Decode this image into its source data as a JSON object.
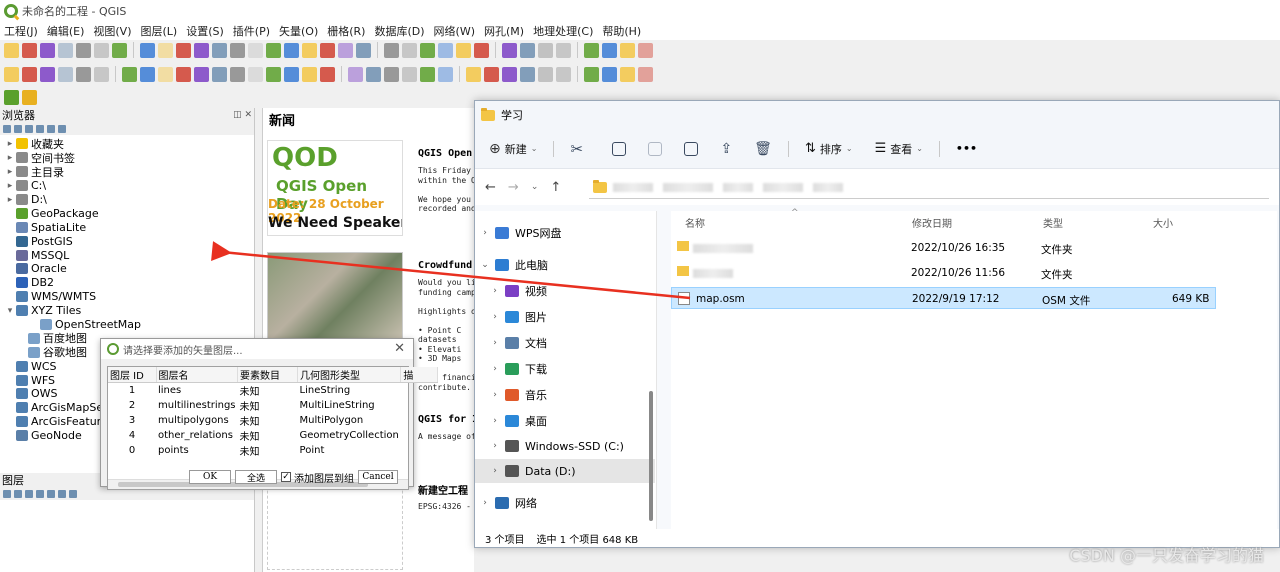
{
  "qgis": {
    "window_title": "未命名的工程 - QGIS",
    "menu": [
      "工程(J)",
      "编辑(E)",
      "视图(V)",
      "图层(L)",
      "设置(S)",
      "插件(P)",
      "矢量(O)",
      "栅格(R)",
      "数据库(D)",
      "网络(W)",
      "网孔(M)",
      "地理处理(C)",
      "帮助(H)"
    ],
    "browser_panel": {
      "title": "浏览器",
      "items": [
        {
          "label": "收藏夹",
          "expand": "▸",
          "color": "#f2c200"
        },
        {
          "label": "空间书签",
          "expand": "▸",
          "color": "#8a8a8a"
        },
        {
          "label": "主目录",
          "expand": "▸",
          "color": "#8a8a8a"
        },
        {
          "label": "C:\\",
          "expand": "▸",
          "color": "#8a8a8a"
        },
        {
          "label": "D:\\",
          "expand": "▸",
          "color": "#8a8a8a"
        },
        {
          "label": "GeoPackage",
          "expand": "",
          "color": "#5aa02c"
        },
        {
          "label": "SpatiaLite",
          "expand": "",
          "color": "#6a88b5"
        },
        {
          "label": "PostGIS",
          "expand": "",
          "color": "#336791"
        },
        {
          "label": "MSSQL",
          "expand": "",
          "color": "#6a6a9a"
        },
        {
          "label": "Oracle",
          "expand": "",
          "color": "#4a6aa0"
        },
        {
          "label": "DB2",
          "expand": "",
          "color": "#2d62b8"
        },
        {
          "label": "WMS/WMTS",
          "expand": "",
          "color": "#4f7fb0"
        },
        {
          "label": "XYZ Tiles",
          "expand": "▾",
          "color": "#4f7fb0"
        },
        {
          "label": "OpenStreetMap",
          "expand": "",
          "color": "#7aa0c8",
          "indent": 2
        },
        {
          "label": "百度地图",
          "expand": "",
          "color": "#7aa0c8",
          "indent": 1
        },
        {
          "label": "谷歌地图",
          "expand": "",
          "color": "#7aa0c8",
          "indent": 1
        },
        {
          "label": "WCS",
          "expand": "",
          "color": "#4f7fb0"
        },
        {
          "label": "WFS",
          "expand": "",
          "color": "#4f7fb0"
        },
        {
          "label": "OWS",
          "expand": "",
          "color": "#4f7fb0"
        },
        {
          "label": "ArcGisMapServer",
          "expand": "",
          "color": "#4f7fb0"
        },
        {
          "label": "ArcGisFeatureServer",
          "expand": "",
          "color": "#4f7fb0"
        },
        {
          "label": "GeoNode",
          "expand": "",
          "color": "#5a7fa8"
        }
      ]
    },
    "layers_panel": {
      "title": "图层"
    },
    "news": {
      "title": "新闻",
      "items": [
        {
          "title": "QGIS Open",
          "body": [
            "This Friday (",
            "within the QG",
            "",
            "We hope you w",
            "recorded and"
          ],
          "thumb": {
            "line1": "QOD",
            "line2": "QGIS Open Day",
            "line3": "Date: 28 October 2022",
            "line4": "We Need Speakers"
          }
        },
        {
          "title": "Crowdfund",
          "body": [
            "Would you li",
            "funding campa",
            "",
            "Highlights of",
            "",
            "• Point C",
            "  datasets",
            "• Elevati",
            "• 3D Maps",
            "",
            "Your financia",
            "contribute."
          ]
        },
        {
          "title": "QGIS for I",
          "body": [
            "A message of"
          ]
        },
        {
          "title": "新建空工程",
          "body": [
            "EPSG:4326 - W"
          ]
        }
      ]
    },
    "vector_dialog": {
      "title": "请选择要添加的矢量图层...",
      "columns": [
        "图层 ID",
        "图层名",
        "要素数目",
        "几何图形类型",
        "描"
      ],
      "rows": [
        {
          "id": "1",
          "name": "lines",
          "count": "未知",
          "geom": "LineString"
        },
        {
          "id": "2",
          "name": "multilinestrings",
          "count": "未知",
          "geom": "MultiLineString"
        },
        {
          "id": "3",
          "name": "multipolygons",
          "count": "未知",
          "geom": "MultiPolygon"
        },
        {
          "id": "4",
          "name": "other_relations",
          "count": "未知",
          "geom": "GeometryCollection"
        },
        {
          "id": "0",
          "name": "points",
          "count": "未知",
          "geom": "Point"
        }
      ],
      "ok_label": "OK",
      "select_all_label": "全选",
      "add_to_group_label": "添加图层到组",
      "add_to_group_checked": true,
      "cancel_label": "Cancel"
    }
  },
  "explorer": {
    "title": "学习",
    "toolbar": {
      "new_label": "新建",
      "sort_label": "排序",
      "view_label": "查看",
      "more_label": "•••"
    },
    "nav": [
      {
        "label": "WPS网盘",
        "expand": "›",
        "color": "#3a7bd5"
      },
      {
        "label": "此电脑",
        "expand": "⌄",
        "color": "#2d7dd2"
      },
      {
        "label": "视频",
        "expand": "›",
        "color": "#7b3fc4"
      },
      {
        "label": "图片",
        "expand": "›",
        "color": "#2b88d8"
      },
      {
        "label": "文档",
        "expand": "›",
        "color": "#5a7fa8"
      },
      {
        "label": "下载",
        "expand": "›",
        "color": "#2a9d5a"
      },
      {
        "label": "音乐",
        "expand": "›",
        "color": "#e05a2a"
      },
      {
        "label": "桌面",
        "expand": "›",
        "color": "#2b88d8"
      },
      {
        "label": "Windows-SSD (C:)",
        "expand": "›",
        "color": "#555"
      },
      {
        "label": "Data (D:)",
        "expand": "›",
        "color": "#555"
      },
      {
        "label": "网络",
        "expand": "›",
        "color": "#2b6cb0"
      }
    ],
    "columns": {
      "name": "名称",
      "modified": "修改日期",
      "type": "类型",
      "size": "大小"
    },
    "files": [
      {
        "name": "",
        "modified": "2022/10/26 16:35",
        "type": "文件夹",
        "size": "",
        "blurred": true
      },
      {
        "name": "",
        "modified": "2022/10/26 11:56",
        "type": "文件夹",
        "size": "",
        "blurred": true
      },
      {
        "name": "map.osm",
        "modified": "2022/9/19 17:12",
        "type": "OSM 文件",
        "size": "649 KB",
        "selected": true
      }
    ],
    "status": {
      "count": "3 个项目",
      "selected": "选中 1 个项目  648 KB"
    }
  },
  "watermark": "CSDN @一只发奋学习的猫"
}
